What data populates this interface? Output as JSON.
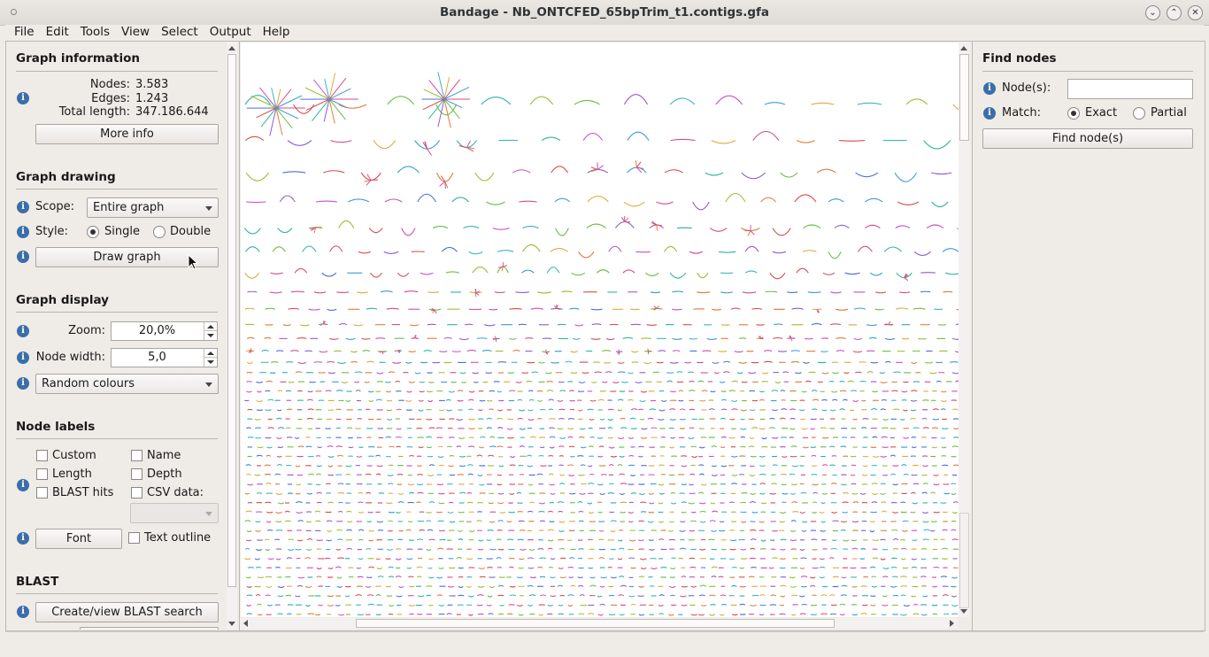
{
  "window": {
    "title": "Bandage - Nb_ONTCFED_65bpTrim_t1.contigs.gfa"
  },
  "menu": [
    "File",
    "Edit",
    "Tools",
    "View",
    "Select",
    "Output",
    "Help"
  ],
  "graph_information": {
    "heading": "Graph information",
    "nodes_label": "Nodes:",
    "nodes_value": "3.583",
    "edges_label": "Edges:",
    "edges_value": "1.243",
    "total_length_label": "Total length:",
    "total_length_value": "347.186.644",
    "more_info_label": "More info"
  },
  "graph_drawing": {
    "heading": "Graph drawing",
    "scope_label": "Scope:",
    "scope_value": "Entire graph",
    "style_label": "Style:",
    "style_single": "Single",
    "style_double": "Double",
    "style_selected": "Single",
    "draw_button": "Draw graph"
  },
  "graph_display": {
    "heading": "Graph display",
    "zoom_label": "Zoom:",
    "zoom_value": "20,0%",
    "node_width_label": "Node width:",
    "node_width_value": "5,0",
    "colour_scheme": "Random colours"
  },
  "node_labels": {
    "heading": "Node labels",
    "custom": "Custom",
    "name": "Name",
    "length": "Length",
    "depth": "Depth",
    "blast_hits": "BLAST hits",
    "csv_data": "CSV data:",
    "font_button": "Font",
    "text_outline": "Text outline"
  },
  "blast": {
    "heading": "BLAST",
    "create_button": "Create/view BLAST search"
  },
  "find_nodes": {
    "heading": "Find nodes",
    "nodes_label": "Node(s):",
    "nodes_value": "",
    "match_label": "Match:",
    "match_exact": "Exact",
    "match_partial": "Partial",
    "match_selected": "Exact",
    "find_button": "Find node(s)"
  },
  "colors": {
    "info_icon": "#3b6ea8",
    "canvas_bg": "#ffffff",
    "window_bg": "#efebe7"
  }
}
